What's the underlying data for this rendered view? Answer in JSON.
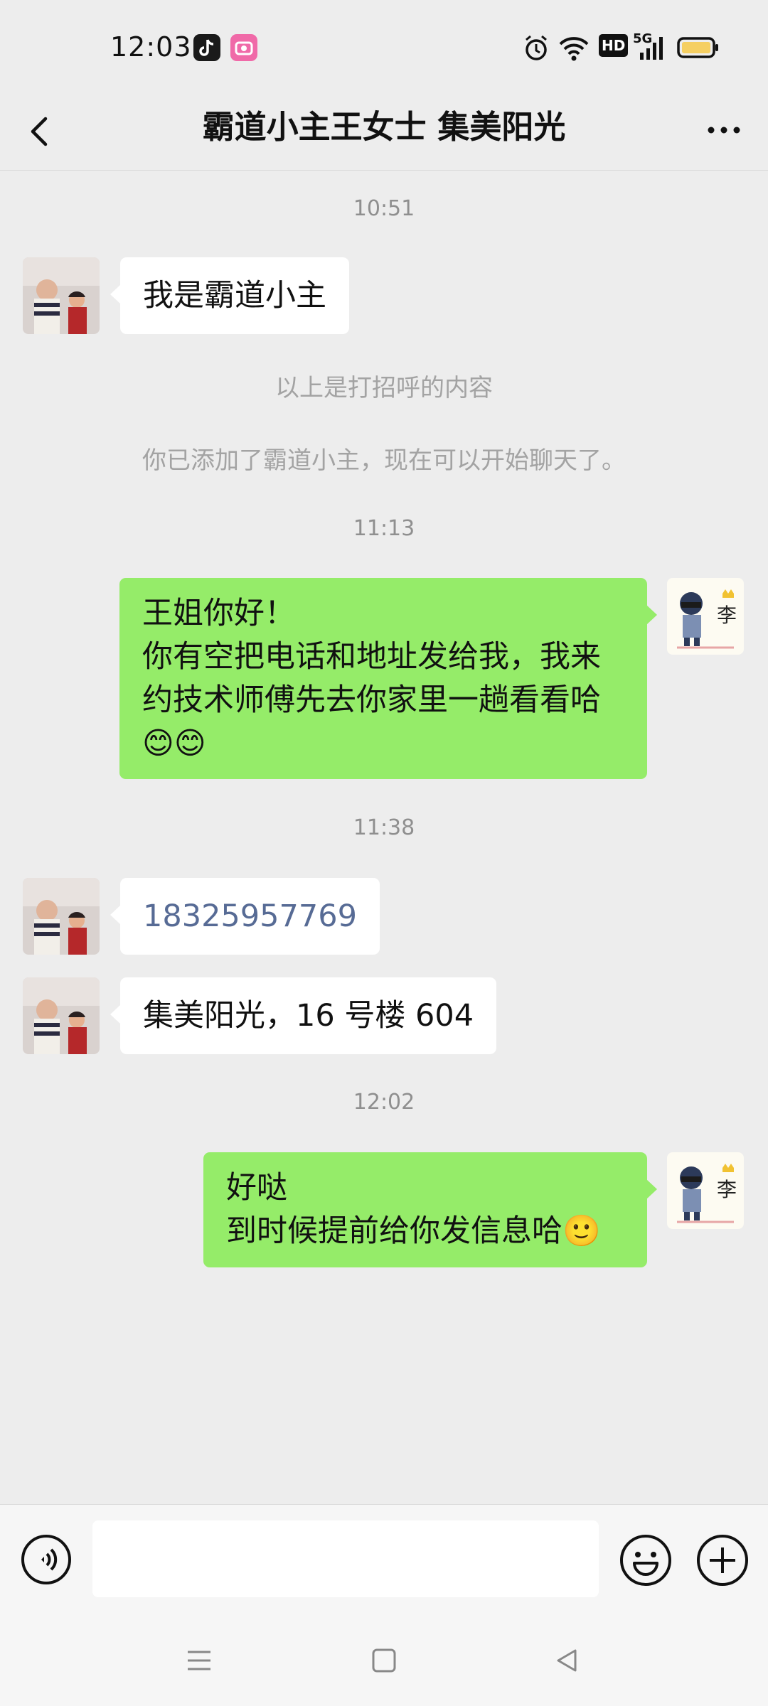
{
  "status_bar": {
    "time": "12:03",
    "hd_label": "HD",
    "network_label": "5G"
  },
  "header": {
    "title": "霸道小主王女士 集美阳光"
  },
  "messages": [
    {
      "type": "time",
      "text": "10:51"
    },
    {
      "type": "in",
      "text": "我是霸道小主"
    },
    {
      "type": "system",
      "text": "以上是打招呼的内容"
    },
    {
      "type": "system",
      "text": "你已添加了霸道小主，现在可以开始聊天了。"
    },
    {
      "type": "time",
      "text": "11:13"
    },
    {
      "type": "out",
      "text": "王姐你好！\n你有空把电话和地址发给我，我来\n约技术师傅先去你家里一趟看看哈\n😊😊"
    },
    {
      "type": "time",
      "text": "11:38"
    },
    {
      "type": "in",
      "text": "18325957769"
    },
    {
      "type": "in",
      "text": "集美阳光，16 号楼 604"
    },
    {
      "type": "time",
      "text": "12:02"
    },
    {
      "type": "out",
      "text": "好哒\n到时候提前给你发信息哈🙂"
    }
  ],
  "input": {
    "placeholder": ""
  },
  "colors": {
    "background": "#ededed",
    "outgoing_bubble": "#95ec69",
    "incoming_bubble": "#ffffff",
    "link": "#576b95"
  },
  "icons": [
    "back-icon",
    "more-icon",
    "voice-icon",
    "emoji-icon",
    "plus-icon",
    "menu-icon",
    "home-icon",
    "back-triangle-icon"
  ]
}
